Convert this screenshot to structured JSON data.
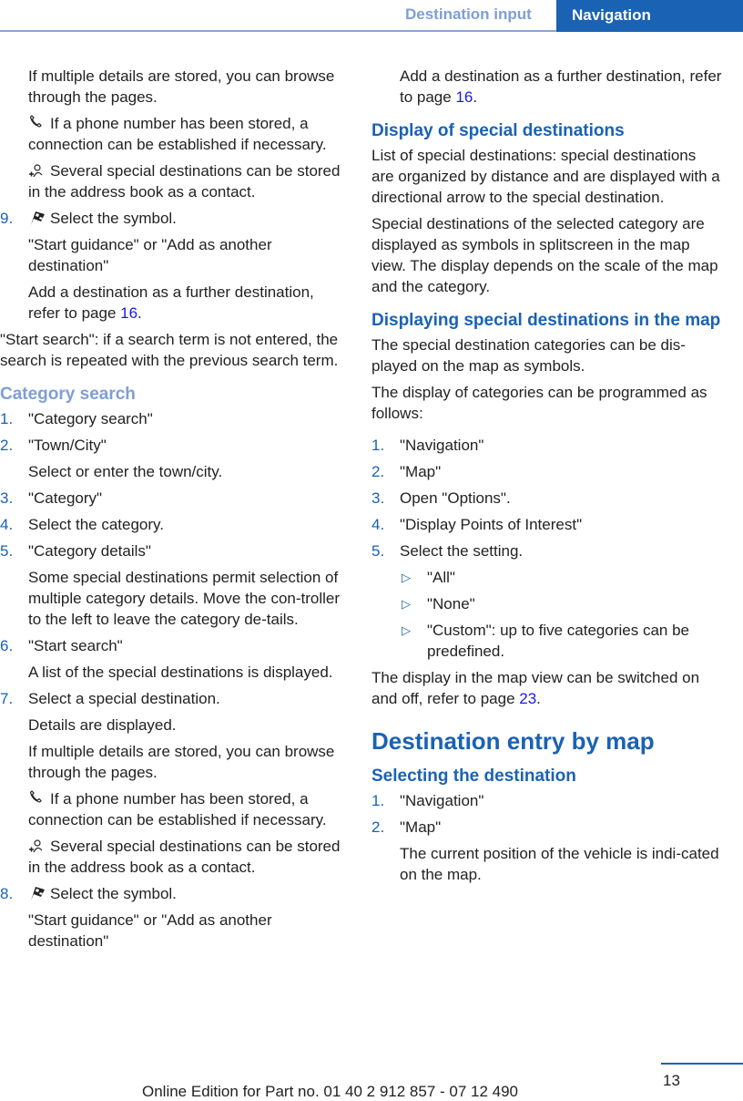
{
  "header": {
    "section": "Destination input",
    "chapter": "Navigation",
    "colors": {
      "accent": "#1a62b4",
      "section": "#7f9ed6",
      "link": "#1a1ae6"
    }
  },
  "left": {
    "intro": {
      "browse": "If multiple details are stored, you can browse through the pages.",
      "phone": "If a phone number has been stored, a connection can be established if necessary.",
      "contact": "Several special destinations can be stored in the address book as a contact."
    },
    "step9": {
      "num": "9.",
      "text": "Select the symbol."
    },
    "step9_detail": "\"Start guidance\" or \"Add as another destination\"",
    "step9_add_pre": "Add a destination as a further destination, refer to page ",
    "step9_add_link": "16",
    "step9_add_post": ".",
    "start_search_note": "\"Start search\": if a search term is not entered, the search is repeated with the previous search term.",
    "category_heading": "Category search",
    "steps": [
      {
        "num": "1.",
        "text": "\"Category search\""
      },
      {
        "num": "2.",
        "text": "\"Town/City\"",
        "detail": "Select or enter the town/city."
      },
      {
        "num": "3.",
        "text": "\"Category\""
      },
      {
        "num": "4.",
        "text": "Select the category."
      },
      {
        "num": "5.",
        "text": "\"Category details\"",
        "detail": "Some special destinations permit selection of multiple category details. Move the con-troller to the left to leave the category de-tails."
      },
      {
        "num": "6.",
        "text": "\"Start search\"",
        "detail": "A list of the special destinations is displayed."
      },
      {
        "num": "7.",
        "text": "Select a special destination.",
        "detail": "Details are displayed."
      }
    ],
    "step7_browse": "If multiple details are stored, you can browse through the pages.",
    "step7_phone": "If a phone number has been stored, a connection can be established if necessary.",
    "step7_contact": "Several special destinations can be stored in the address book as a contact.",
    "step8": {
      "num": "8.",
      "text": "Select the symbol."
    },
    "step8_detail": "\"Start guidance\" or \"Add as another destination\""
  },
  "right": {
    "add_pre": "Add a destination as a further destination, refer to page ",
    "add_link": "16",
    "add_post": ".",
    "display_heading": "Display of special destinations",
    "display_p1": "List of special destinations: special destinations are organized by distance and are displayed with a directional arrow to the special destination.",
    "display_p2": "Special destinations of the selected category are displayed as symbols in splitscreen in the map view. The display depends on the scale of the map and the category.",
    "map_heading": "Displaying special destinations in the map",
    "map_p1": "The special destination categories can be dis-played on the map as symbols.",
    "map_p2": "The display of categories can be programmed as follows:",
    "steps": [
      {
        "num": "1.",
        "text": "\"Navigation\""
      },
      {
        "num": "2.",
        "text": "\"Map\""
      },
      {
        "num": "3.",
        "text": "Open \"Options\"."
      },
      {
        "num": "4.",
        "text": "\"Display Points of Interest\""
      },
      {
        "num": "5.",
        "text": "Select the setting."
      }
    ],
    "settings": [
      "\"All\"",
      "\"None\"",
      "\"Custom\": up to five categories can be predefined."
    ],
    "switch_pre": "The display in the map view can be switched on and off, refer to page ",
    "switch_link": "23",
    "switch_post": ".",
    "entry_heading": "Destination entry by map",
    "select_heading": "Selecting the destination",
    "select_steps": [
      {
        "num": "1.",
        "text": "\"Navigation\""
      },
      {
        "num": "2.",
        "text": "\"Map\"",
        "detail": "The current position of the vehicle is indi-cated on the map."
      }
    ]
  },
  "footer": {
    "page_number": "13",
    "edition": "Online Edition for Part no. 01 40 2 912 857 - 07 12 490"
  }
}
